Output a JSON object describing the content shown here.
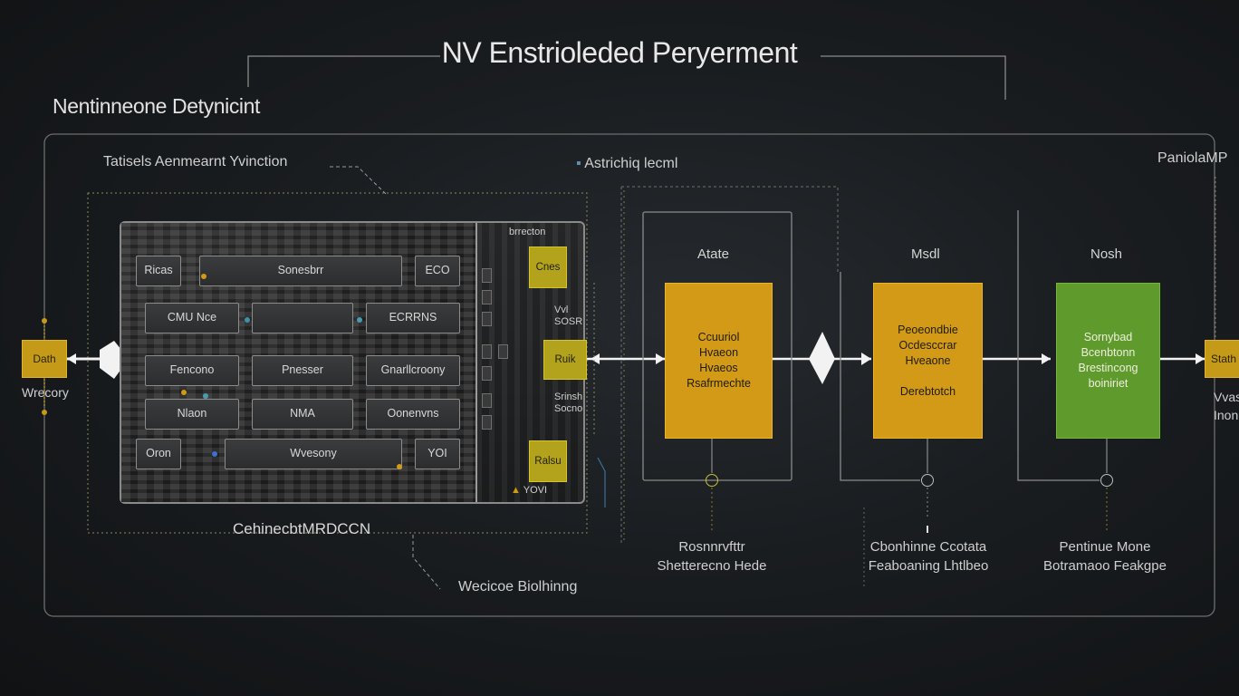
{
  "title": "NV Enstrioleded Peryerment",
  "subtitle": "Nentinneone Detynicint",
  "chip": {
    "top_label": "Tatisels Aenmearnt Yvinction",
    "bottom_label": "CehinecbtMRDCCN",
    "modules": [
      "Ricas",
      "Sonesbrr",
      "ECO",
      "CMU Nce",
      "",
      "ECRRNS",
      "Fencono",
      "Pnesser",
      "Gnarllcroony",
      "Nlaon",
      "NMA",
      "Oonenvns",
      "Oron",
      "Wvesony",
      "YOI"
    ],
    "right_labels": [
      "brrecton",
      "Vvl\nSOSR",
      "Srinsh\nSocno",
      "YOVI"
    ],
    "yellow_chips": [
      "Cnes",
      "Ruik",
      "Ralsu"
    ]
  },
  "left_io": {
    "label": "Dath",
    "caption": "Wrecory"
  },
  "right_io": {
    "label": "Stath",
    "caption": "Vvas\nInon",
    "top_label": "PaniolaMP"
  },
  "annotation_top": "Astrichiq lecml",
  "annotation_bottom": "Wecicoe Biolhinng",
  "stages": [
    {
      "head": "Atate",
      "body": "Ccuuriol\nHvaeon\nHvaeos\nRsafrmechte",
      "caption": "Rosnnrvfttr\nShetterecno Hede",
      "color": "orange"
    },
    {
      "head": "Msdl",
      "body": "Peoeondbie\nOcdesccrar\nHveaone\n\nDerebtotch",
      "caption": "Cbonhinne Ccotata\nFeaboaning Lhtlbeo",
      "color": "orange"
    },
    {
      "head": "Nosh",
      "body": "Sornybad\nBcenbtonn\nBrestincong\nboiniriet",
      "caption": "Pentinue Mone\nBotramaoo Feakgpe",
      "color": "green"
    }
  ],
  "colors": {
    "orange": "#d39a17",
    "yellow": "#b3a31c",
    "green": "#5f9a2c",
    "background": "#1a1d20"
  }
}
